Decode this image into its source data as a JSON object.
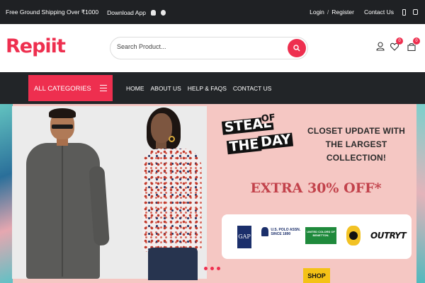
{
  "topbar": {
    "shipping_text": "Free Ground Shipping Over ₹1000",
    "download_text": "Download App",
    "login": "Login",
    "register": "Register",
    "contact": "Contact Us"
  },
  "header": {
    "logo_text": "Repiit",
    "search_placeholder": "Search Product...",
    "wishlist_count": "0",
    "cart_count": "0"
  },
  "nav": {
    "all_categories": "ALL CATEGORIES",
    "links": [
      "HOME",
      "ABOUT US",
      "HELP & FAQS",
      "CONTACT US"
    ]
  },
  "hero": {
    "steal_line1": "STEAL",
    "steal_line2": "OF",
    "steal_line3": "THE",
    "steal_line4": "DAY",
    "closet_line1": "CLOSET UPDATE WITH",
    "closet_line2": "THE LARGEST COLLECTION!",
    "offer": "EXTRA 30% OFF*",
    "brands": {
      "gap": "GAP",
      "uspa_line1": "U.S. POLO ASSN.",
      "uspa_line2": "SINCE 1890",
      "ucb": "UNITED COLORS OF BENETTON.",
      "outryt": "OUTRYT"
    },
    "shop_button": "SHOP"
  },
  "colors": {
    "accent": "#ee2f4f",
    "topbar_bg": "#1f2124",
    "nav_bg": "#222528",
    "hero_bg": "#f5c7c3",
    "offer_text": "#c2424b",
    "shop_button": "#f4c216"
  }
}
